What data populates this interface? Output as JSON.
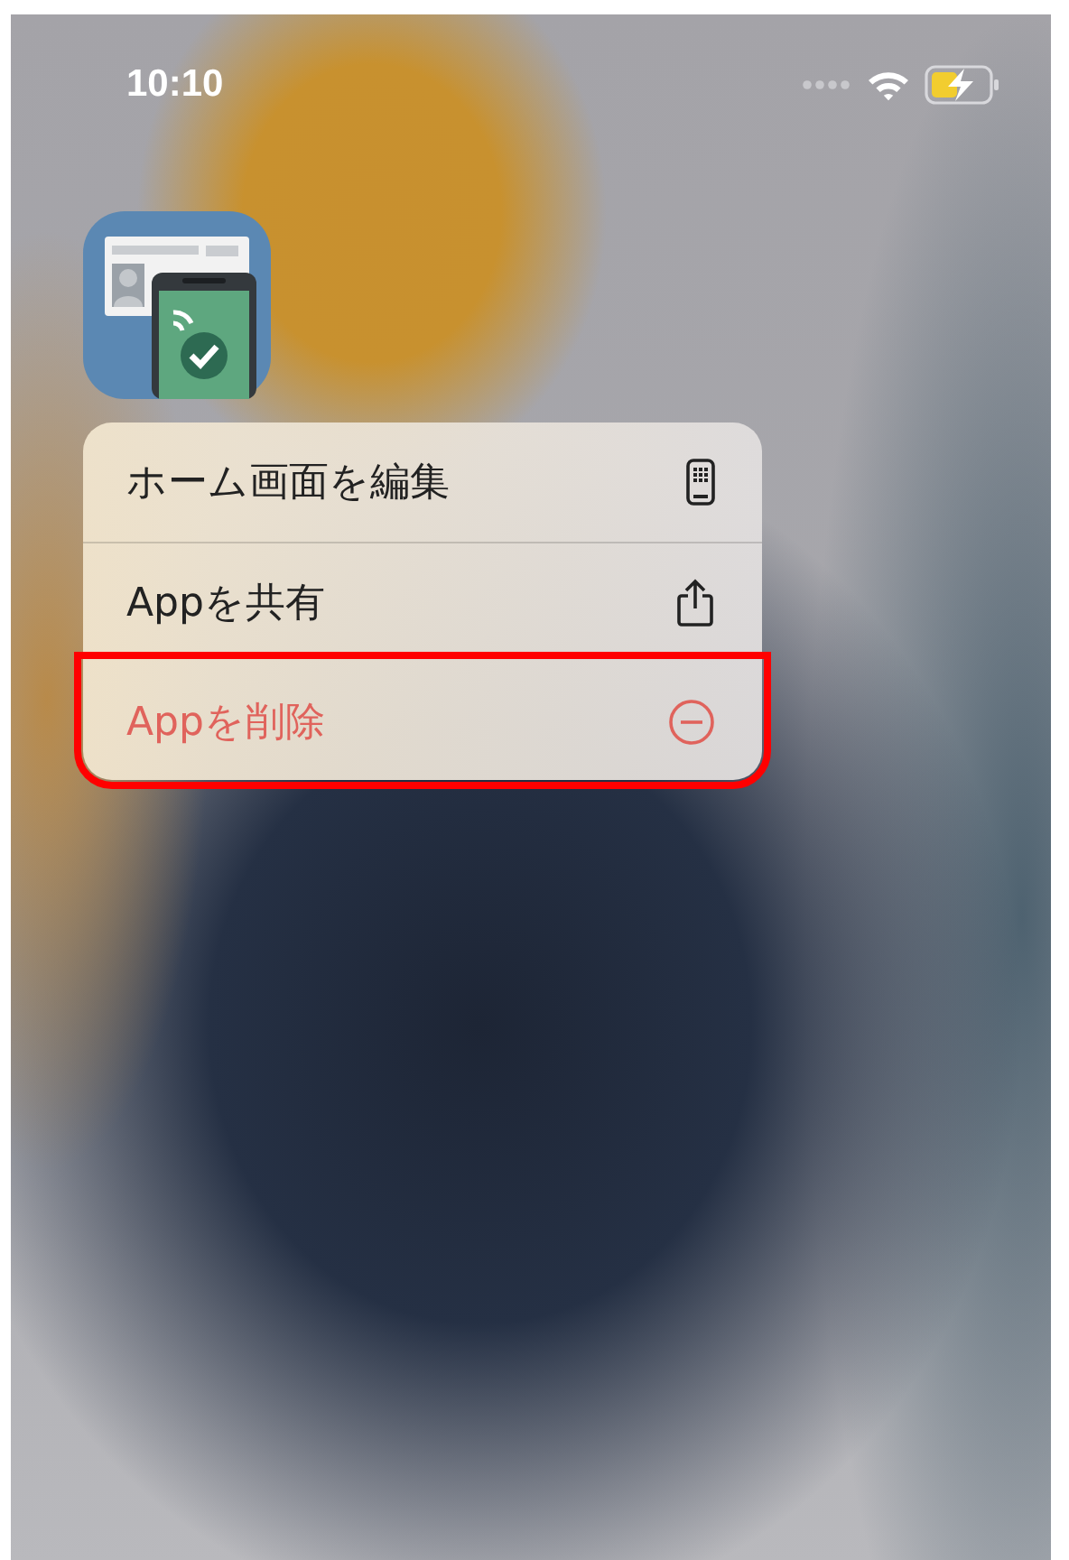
{
  "status_bar": {
    "time": "10:10"
  },
  "context_menu": {
    "items": [
      {
        "label": "ホーム画面を編集",
        "kind": "edit-home",
        "destructive": false,
        "highlighted": false
      },
      {
        "label": "Appを共有",
        "kind": "share",
        "destructive": false,
        "highlighted": false
      },
      {
        "label": "Appを削除",
        "kind": "delete",
        "destructive": true,
        "highlighted": true
      }
    ]
  }
}
